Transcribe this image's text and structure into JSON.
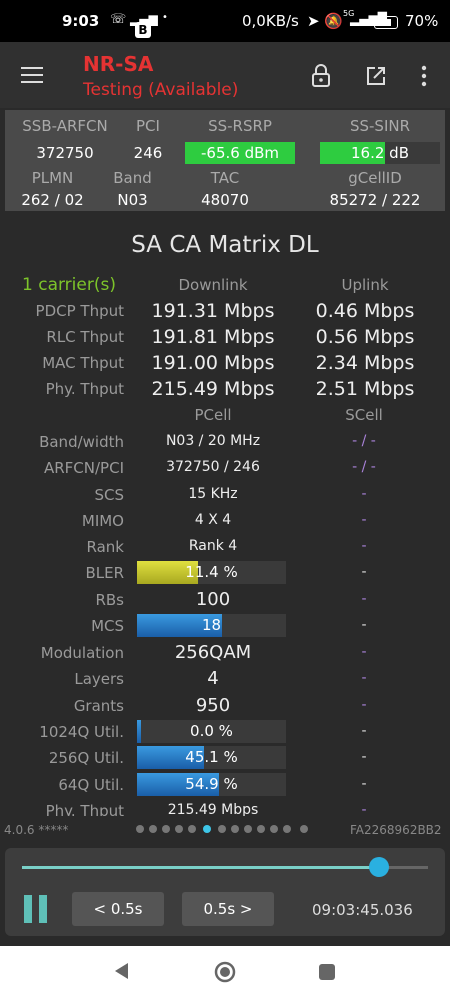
{
  "status": {
    "time": "9:03",
    "rate": "0,0KB/s",
    "battery": "70%",
    "net": "5G"
  },
  "app": {
    "title": "NR-SA",
    "subtitle": "Testing (Available)"
  },
  "cell": {
    "hdr": {
      "ssb": "SSB-ARFCN",
      "pci": "PCI",
      "rsrp": "SS-RSRP",
      "sinr": "SS-SINR",
      "plmn": "PLMN",
      "band": "Band",
      "tac": "TAC",
      "gcell": "gCellID"
    },
    "ssb": "372750",
    "pci": "246",
    "rsrp": "-65.6 dBm",
    "sinr": "16.2 dB",
    "plmn": "262 / 02",
    "band": "N03",
    "tac": "48070",
    "gcell": "85272 / 222"
  },
  "matrix": {
    "title": "SA CA Matrix DL",
    "carriers": "1 carrier(s)",
    "downlink": "Downlink",
    "uplink": "Uplink",
    "thput": [
      {
        "label": "PDCP Thput",
        "dl": "191.31 Mbps",
        "ul": "0.46 Mbps"
      },
      {
        "label": "RLC Thput",
        "dl": "191.81 Mbps",
        "ul": "0.56 Mbps"
      },
      {
        "label": "MAC Thput",
        "dl": "191.00 Mbps",
        "ul": "2.34 Mbps"
      },
      {
        "label": "Phy. Thput",
        "dl": "215.49 Mbps",
        "ul": "2.51 Mbps"
      }
    ],
    "pcell": "PCell",
    "scell": "SCell",
    "rows": {
      "band": {
        "label": "Band/width",
        "p": "N03 / 20 MHz",
        "s": "- / -"
      },
      "arfcn": {
        "label": "ARFCN/PCI",
        "p": "372750 / 246",
        "s": "- / -"
      },
      "scs": {
        "label": "SCS",
        "p": "15 KHz",
        "s": "-"
      },
      "mimo": {
        "label": "MIMO",
        "p": "4 X 4",
        "s": "-"
      },
      "rank": {
        "label": "Rank",
        "p": "Rank 4",
        "s": "-"
      },
      "bler": {
        "label": "BLER",
        "p": "11.4 %",
        "s": "-",
        "level": 0.41
      },
      "rbs": {
        "label": "RBs",
        "p": "100",
        "s": "-"
      },
      "mcs": {
        "label": "MCS",
        "p": "18",
        "s": "-",
        "level": 0.57
      },
      "mod": {
        "label": "Modulation",
        "p": "256QAM",
        "s": "-"
      },
      "layers": {
        "label": "Layers",
        "p": "4",
        "s": "-"
      },
      "grants": {
        "label": "Grants",
        "p": "950",
        "s": "-"
      },
      "q1024": {
        "label": "1024Q Util.",
        "p": "0.0 %",
        "s": "-",
        "level": 0.0
      },
      "q256": {
        "label": "256Q Util.",
        "p": "45.1 %",
        "s": "-",
        "level": 0.451
      },
      "q64": {
        "label": "64Q Util.",
        "p": "54.9 %",
        "s": "-",
        "level": 0.549
      },
      "phy": {
        "label": "Phy. Thput",
        "p": "215.49 Mbps",
        "s": "-"
      }
    }
  },
  "footer": {
    "version": "4.0.6 *****",
    "device": "FA2268962BB2"
  },
  "player": {
    "back": "< 0.5s",
    "fwd": "0.5s >",
    "time": "09:03:45.036",
    "progress": 0.88
  },
  "colors": {
    "green": "#2ecc40",
    "yellow": "#c8c830",
    "blue": "#1f78c8",
    "teal": "#7ad0c8",
    "purple": "#a982d9",
    "red": "#e53333"
  }
}
